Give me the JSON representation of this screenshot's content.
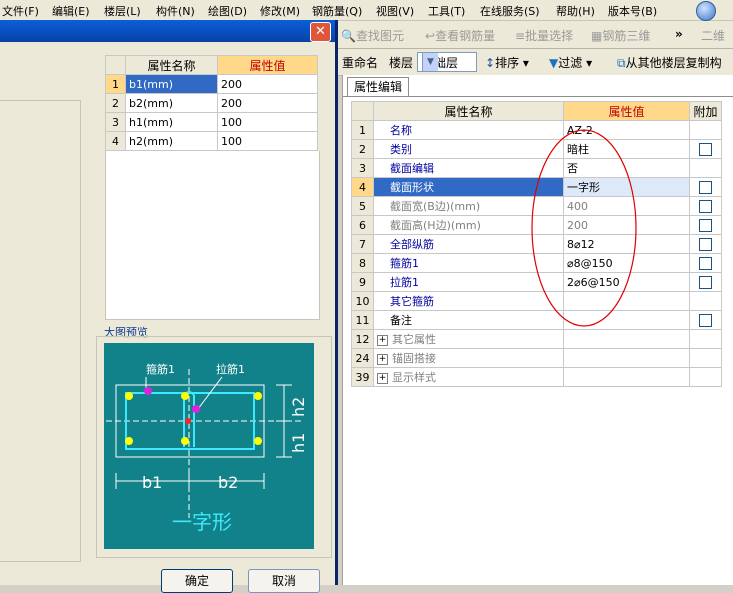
{
  "menu": {
    "items": [
      "文件(F)",
      "编辑(E)",
      "楼层(L)",
      "构件(N)",
      "绘图(D)",
      "修改(M)",
      "钢筋量(Q)",
      "视图(V)",
      "工具(T)",
      "在线服务(S)",
      "帮助(H)",
      "版本号(B)"
    ]
  },
  "toolbar_top": {
    "find_element": "查找图元",
    "view_rebar": "查看钢筋量",
    "batch_select": "批量选择",
    "rebar_3d": "钢筋三维",
    "more": "»",
    "two_d": "二维"
  },
  "toolbar_main": {
    "rename": "重命名",
    "floor_label": "楼层",
    "floor_value": "基础层",
    "sort": "排序",
    "filter": "过滤",
    "copy_from_other": "从其他楼层复制构"
  },
  "panel": {
    "tab_label": "属性编辑",
    "headers": {
      "name": "属性名称",
      "value": "属性值",
      "extra": "附加"
    },
    "rows": [
      {
        "idx": "1",
        "name": "名称",
        "value": "AZ-2"
      },
      {
        "idx": "2",
        "name": "类别",
        "value": "暗柱"
      },
      {
        "idx": "3",
        "name": "截面编辑",
        "value": "否"
      },
      {
        "idx": "4",
        "name": "截面形状",
        "value": "一字形"
      },
      {
        "idx": "5",
        "name": "截面宽(B边)(mm)",
        "value": "400"
      },
      {
        "idx": "6",
        "name": "截面高(H边)(mm)",
        "value": "200"
      },
      {
        "idx": "7",
        "name": "全部纵筋",
        "value": "8⌀12"
      },
      {
        "idx": "8",
        "name": "箍筋1",
        "value": "⌀8@150"
      },
      {
        "idx": "9",
        "name": "拉筋1",
        "value": "2⌀6@150"
      },
      {
        "idx": "10",
        "name": "其它箍筋",
        "value": ""
      },
      {
        "idx": "11",
        "name": "备注",
        "value": ""
      },
      {
        "idx": "12",
        "name": "其它属性",
        "value": ""
      },
      {
        "idx": "24",
        "name": "锚固搭接",
        "value": ""
      },
      {
        "idx": "39",
        "name": "显示样式",
        "value": ""
      }
    ]
  },
  "dialog": {
    "table_headers": {
      "name": "属性名称",
      "value": "属性值"
    },
    "rows": [
      {
        "idx": "1",
        "name": "b1(mm)",
        "value": "200"
      },
      {
        "idx": "2",
        "name": "b2(mm)",
        "value": "200"
      },
      {
        "idx": "3",
        "name": "h1(mm)",
        "value": "100"
      },
      {
        "idx": "4",
        "name": "h2(mm)",
        "value": "100"
      }
    ],
    "preview_label": "大图预览",
    "preview": {
      "stirrup_label": "箍筋1",
      "tie_label": "拉筋1",
      "b1": "b1",
      "b2": "b2",
      "h1": "h1",
      "h2": "h2",
      "shape_name": "一字形"
    },
    "ok_label": "确定",
    "cancel_label": "取消"
  },
  "colors": {
    "preview_bg": "#12828a",
    "rebar_line": "#40e8ff",
    "dot_yellow": "#ffff00",
    "dot_magenta": "#e020e0",
    "dot_red": "#ff2020",
    "annotation_red": "#e00000"
  }
}
